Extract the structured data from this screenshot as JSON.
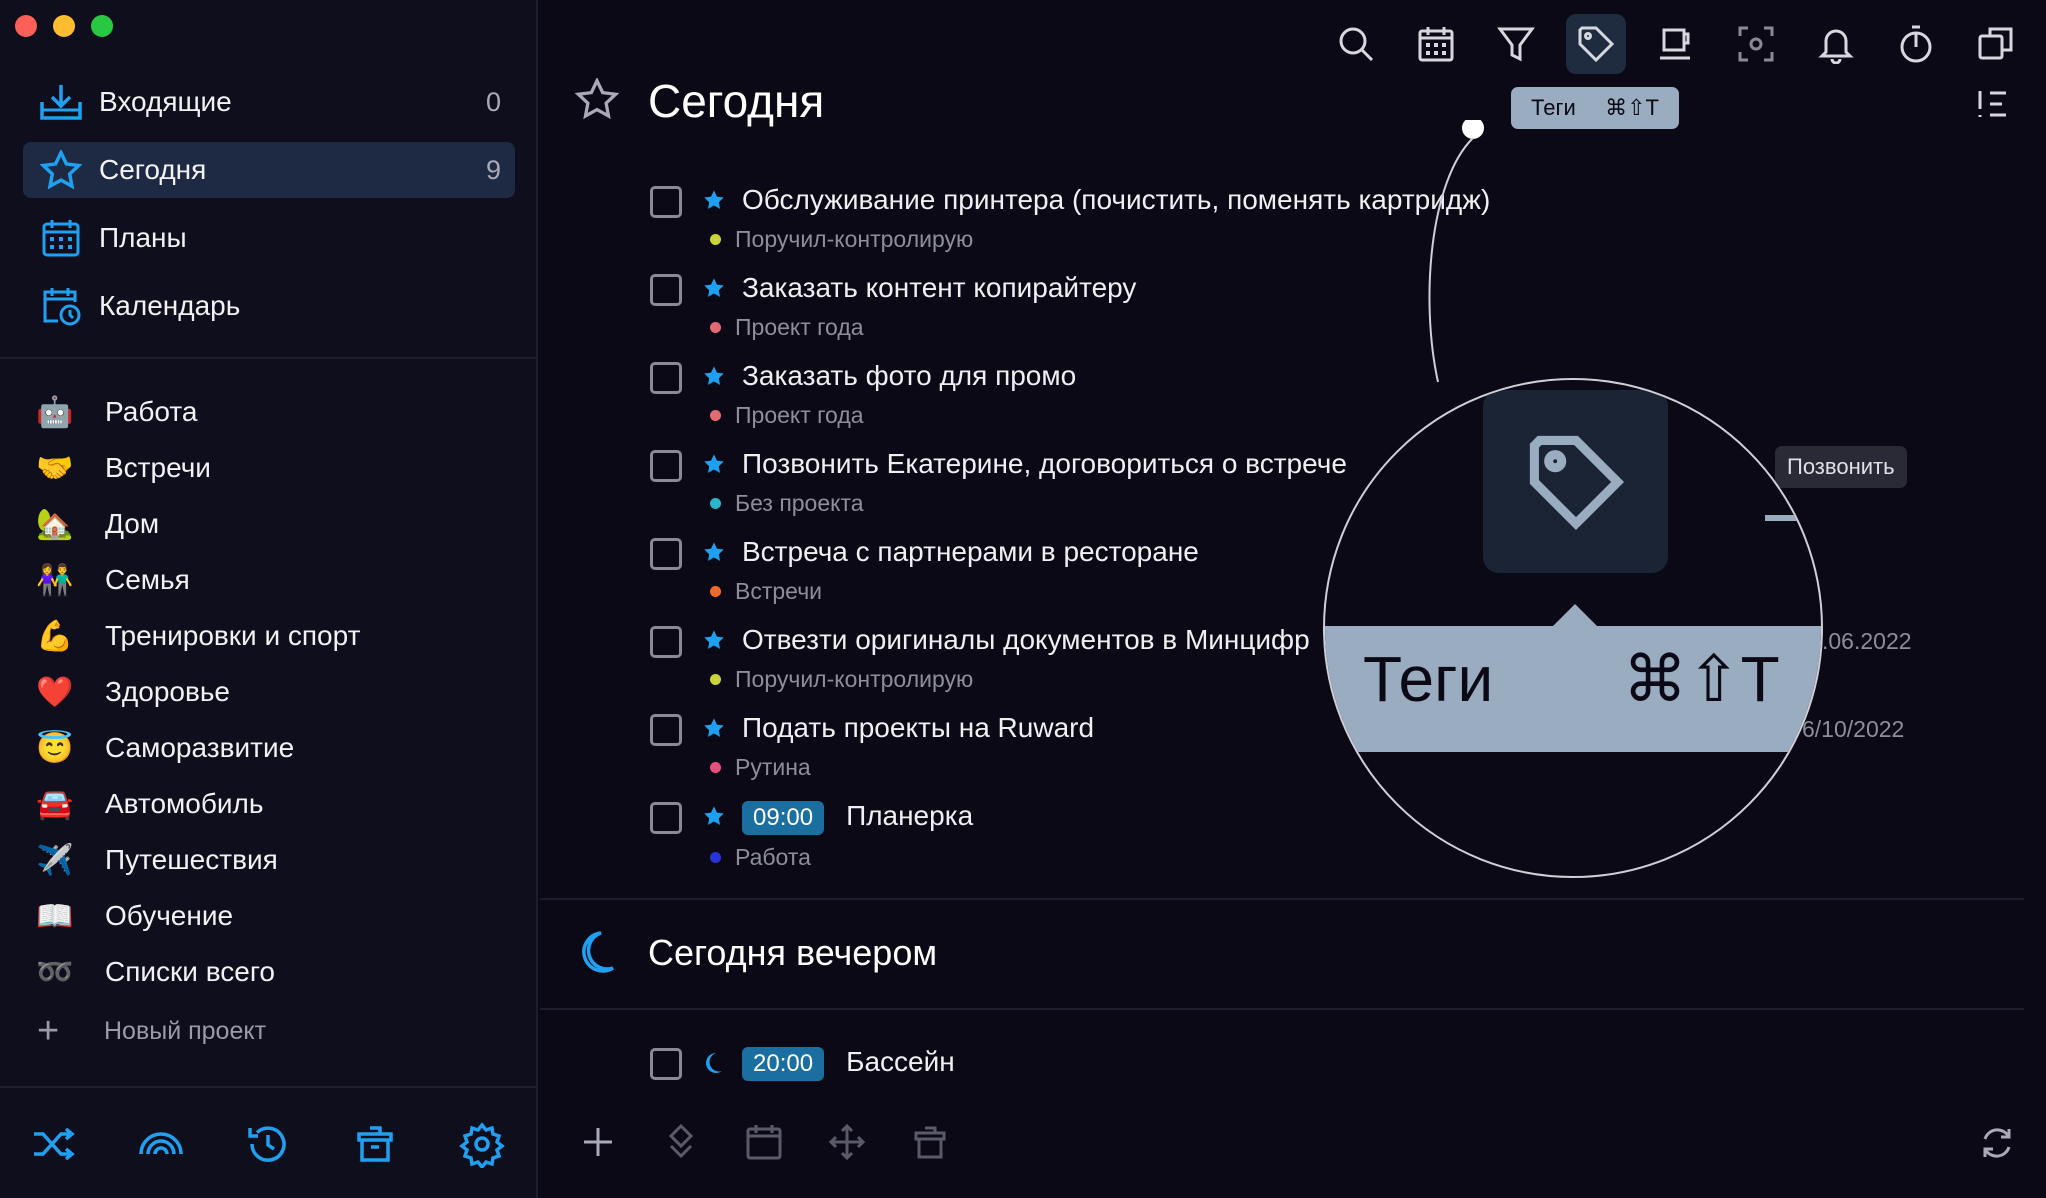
{
  "sidebar": {
    "nav": [
      {
        "label": "Входящие",
        "count": "0",
        "icon": "inbox-icon"
      },
      {
        "label": "Сегодня",
        "count": "9",
        "icon": "star-icon"
      },
      {
        "label": "Планы",
        "count": "",
        "icon": "calendar-grid-icon"
      },
      {
        "label": "Календарь",
        "count": "",
        "icon": "calendar-clock-icon"
      }
    ],
    "projects": [
      {
        "label": "Работа",
        "emoji": "🤖"
      },
      {
        "label": "Встречи",
        "emoji": "🤝"
      },
      {
        "label": "Дом",
        "emoji": "🏡"
      },
      {
        "label": "Семья",
        "emoji": "👫"
      },
      {
        "label": "Тренировки и спорт",
        "emoji": "💪"
      },
      {
        "label": "Здоровье",
        "emoji": "❤️"
      },
      {
        "label": "Саморазвитие",
        "emoji": "😇"
      },
      {
        "label": "Автомобиль",
        "emoji": "🚘"
      },
      {
        "label": "Путешествия",
        "emoji": "✈️"
      },
      {
        "label": "Обучение",
        "emoji": "📖"
      },
      {
        "label": "Списки всего",
        "emoji": "➿"
      }
    ],
    "new_project": "Новый проект",
    "new_project_icon": "+"
  },
  "toolbar": {
    "tooltip_label": "Теги",
    "tooltip_shortcut": "⌘⇧T"
  },
  "main": {
    "title": "Сегодня",
    "tasks": [
      {
        "text": "Обслуживание принтера (почистить, поменять картридж)",
        "project": "Поручил-контролирую",
        "dot": "#c8d43a",
        "time": "",
        "date": ""
      },
      {
        "text": "Заказать контент копирайтеру",
        "project": "Проект года",
        "dot": "#e26a72",
        "time": "",
        "date": ""
      },
      {
        "text": "Заказать фото для промо",
        "project": "Проект года",
        "dot": "#e26a72",
        "time": "",
        "date": ""
      },
      {
        "text": "Позвонить Екатерине, договориться о встрече",
        "project": "Без проекта",
        "dot": "#29b5cc",
        "time": "",
        "date": ""
      },
      {
        "text": "Встреча с партнерами в ресторане",
        "project": "Встречи",
        "dot": "#f06a2b",
        "time": "",
        "date": ""
      },
      {
        "text": "Отвезти оригиналы документов в Минцифр",
        "project": "Поручил-контролирую",
        "dot": "#c8d43a",
        "time": "",
        "date": ".06.2022"
      },
      {
        "text": "Подать проекты на Ruward",
        "project": "Рутина",
        "dot": "#e5517c",
        "time": "",
        "date": "6/10/2022"
      },
      {
        "text": "Планерка",
        "project": "Работа",
        "dot": "#2734d8",
        "time": "09:00",
        "date": ""
      }
    ],
    "evening_title": "Сегодня вечером",
    "evening_task": {
      "text": "Бассейн",
      "time": "20:00"
    },
    "call_badge": "Позвонить",
    "magnifier": {
      "label": "Теги",
      "shortcut": "⌘⇧T"
    }
  }
}
